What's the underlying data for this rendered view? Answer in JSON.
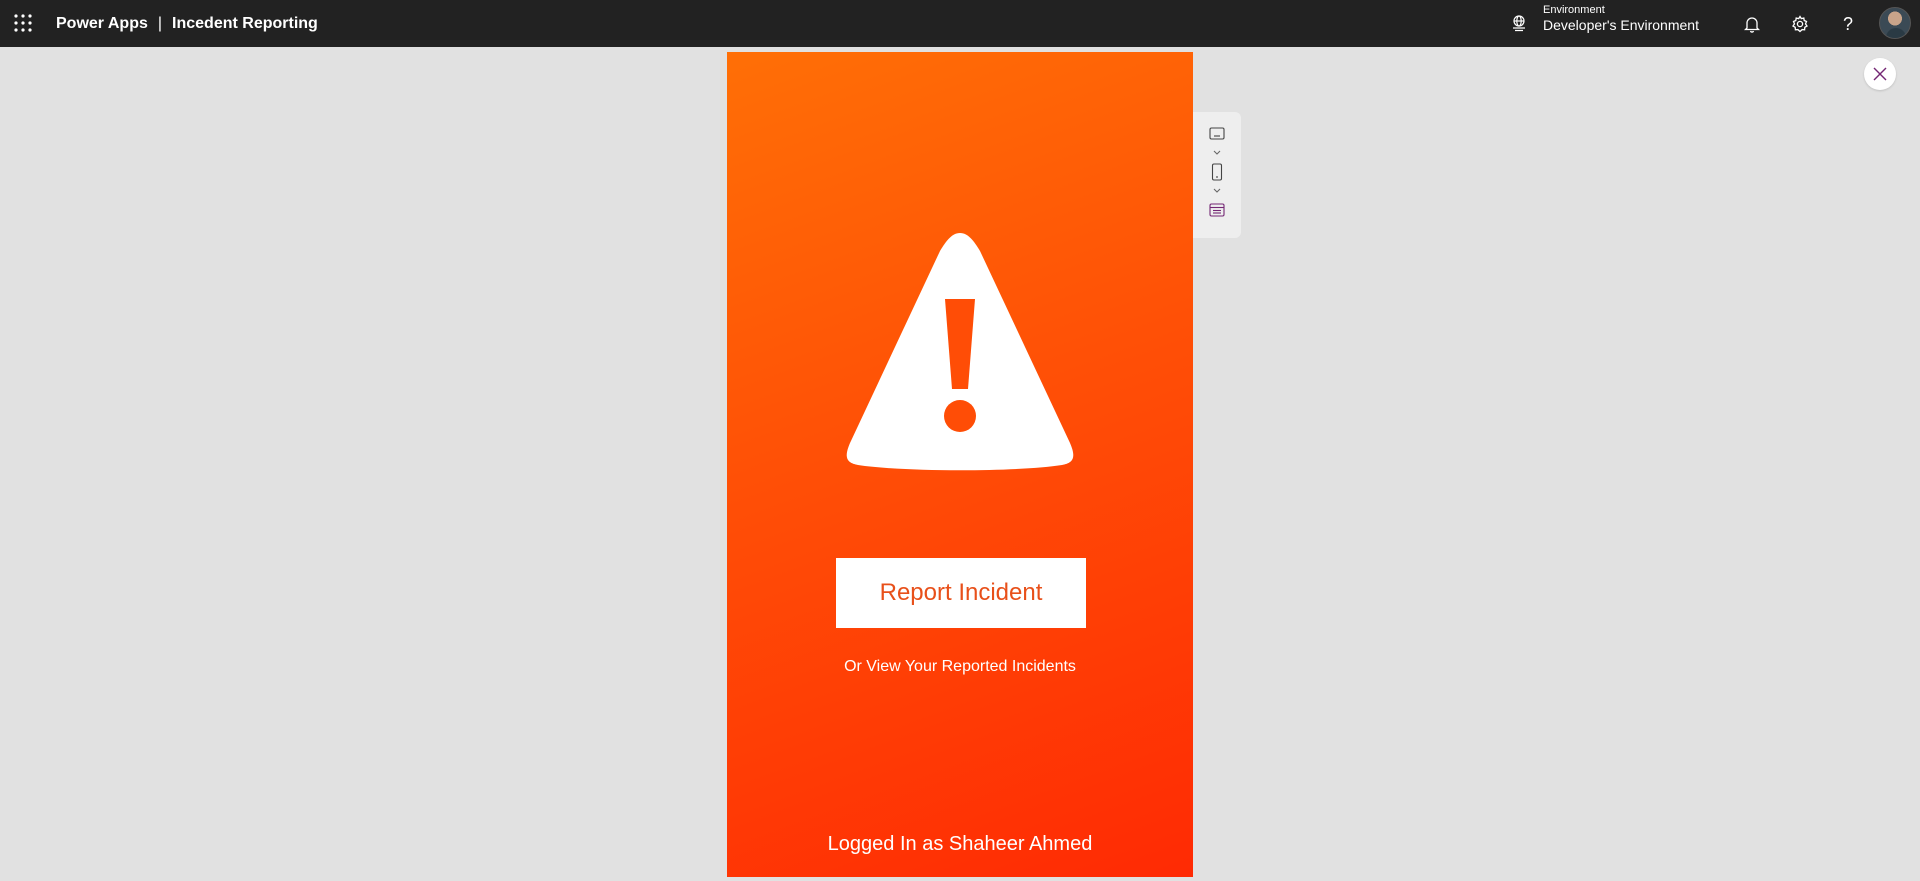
{
  "header": {
    "app_name": "Power Apps",
    "separator": "|",
    "app_title": "Incedent Reporting",
    "environment_label": "Environment",
    "environment_value": "Developer's Environment",
    "help_glyph": "?"
  },
  "icons": {
    "waffle": "waffle-icon",
    "environment": "environment-icon",
    "notifications": "bell-icon",
    "settings": "gear-icon",
    "help": "help-icon",
    "close": "close-icon",
    "warning": "warning-icon",
    "keyboard": "keyboard-icon",
    "phone": "phone-icon",
    "screen": "screen-icon"
  },
  "app": {
    "report_button_label": "Report Incident",
    "view_link_text": "Or View Your Reported Incidents",
    "logged_in_text": "Logged In as Shaheer Ahmed"
  },
  "colors": {
    "header_bg": "#222222",
    "canvas_bg": "#e1e1e1",
    "app_gradient_start": "#ff6f06",
    "app_gradient_end": "#ff2a04",
    "button_text": "#e8501a",
    "accent_purple": "#742774"
  }
}
